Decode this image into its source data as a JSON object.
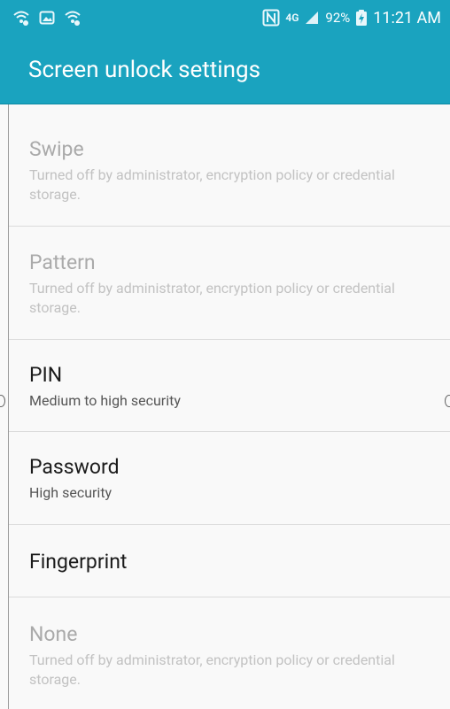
{
  "status_bar": {
    "battery": "92%",
    "time": "11:21 AM",
    "network": "4G",
    "icons": [
      "wifi-icon",
      "gallery-notification-icon",
      "wifi-calling-icon",
      "nfc-icon",
      "4g-icon",
      "signal-icon",
      "battery-charging-icon"
    ]
  },
  "header": {
    "title": "Screen unlock settings"
  },
  "options": [
    {
      "title": "Swipe",
      "description": "Turned off by administrator, encryption policy or credential storage.",
      "enabled": false
    },
    {
      "title": "Pattern",
      "description": "Turned off by administrator, encryption policy or credential storage.",
      "enabled": false
    },
    {
      "title": "PIN",
      "description": "Medium to high security",
      "enabled": true
    },
    {
      "title": "Password",
      "description": "High security",
      "enabled": true
    },
    {
      "title": "Fingerprint",
      "description": "",
      "enabled": true
    },
    {
      "title": "None",
      "description": "Turned off by administrator, encryption policy or credential storage.",
      "enabled": false
    }
  ],
  "colors": {
    "accent": "#1aa3bf",
    "disabled_text": "#aaaaaa",
    "background": "#f9f9f9"
  }
}
